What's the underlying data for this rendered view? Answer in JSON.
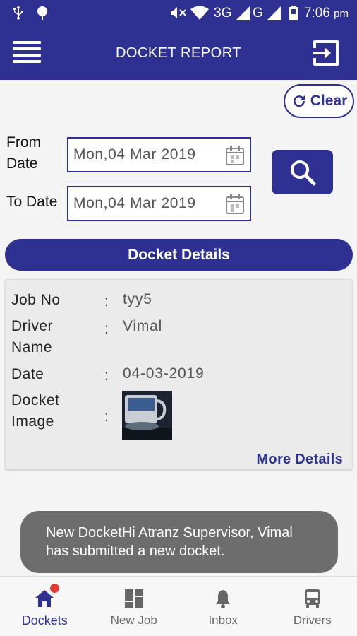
{
  "status_bar": {
    "time": "7:06",
    "time_suffix": "pm",
    "network1": "3G",
    "network2": "G",
    "icons": [
      "usb-icon",
      "android-debug-icon",
      "mute-icon",
      "wifi-icon",
      "signal-icon",
      "battery-icon"
    ]
  },
  "app_bar": {
    "title": "DOCKET REPORT",
    "menu_icon": "hamburger-icon",
    "logout_icon": "logout-icon"
  },
  "clear_label": "Clear",
  "filters": {
    "from_label_line1": "From",
    "from_label_line2": "Date",
    "from_value": "Mon,04 Mar 2019",
    "to_label": "To Date",
    "to_value": "Mon,04 Mar 2019"
  },
  "section_title": "Docket Details",
  "docket": {
    "job_no_label": "Job No",
    "job_no_value": "tyy5",
    "driver_label_line1": "Driver",
    "driver_label_line2": "Name",
    "driver_value": "Vimal",
    "date_label": "Date",
    "date_value": "04-03-2019",
    "image_label_line1": "Docket",
    "image_label_line2": "Image",
    "separator": ":",
    "more_details": "More Details"
  },
  "toast": {
    "line1": "New DocketHi Atranz Supervisor, Vimal",
    "line2": "has submitted a new docket."
  },
  "bottom_nav": [
    {
      "label": "Dockets",
      "icon": "home-icon",
      "active": true,
      "badge": true
    },
    {
      "label": "New Job",
      "icon": "dashboard-icon",
      "active": false
    },
    {
      "label": "Inbox",
      "icon": "bell-icon",
      "active": false
    },
    {
      "label": "Drivers",
      "icon": "bus-icon",
      "active": false
    }
  ],
  "colors": {
    "primary": "#2e3192",
    "toast": "#6d6d6d",
    "badge": "#e53935"
  }
}
